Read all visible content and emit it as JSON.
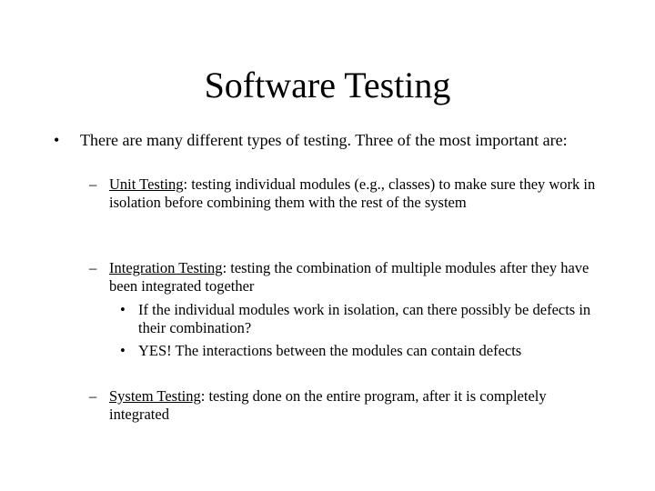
{
  "slide": {
    "title": "Software Testing",
    "intro": {
      "bullet": "•",
      "text": "There are many different types of testing.  Three of the most important are:"
    },
    "items": [
      {
        "dash": "–",
        "term": "Unit Testing",
        "text": ": testing individual modules (e.g., classes) to make sure they work in isolation before combining them with the rest of the system"
      },
      {
        "dash": "–",
        "term": "Integration Testing",
        "text": ": testing the combination of multiple modules after they have been integrated together",
        "subitems": [
          {
            "bullet": "•",
            "text": "If the individual modules work in isolation, can there possibly be defects in their combination?"
          },
          {
            "bullet": "•",
            "text": "YES!  The interactions between the modules can contain defects"
          }
        ]
      },
      {
        "dash": "–",
        "term": "System Testing",
        "text": ": testing done on the entire program, after it is completely integrated"
      }
    ]
  }
}
